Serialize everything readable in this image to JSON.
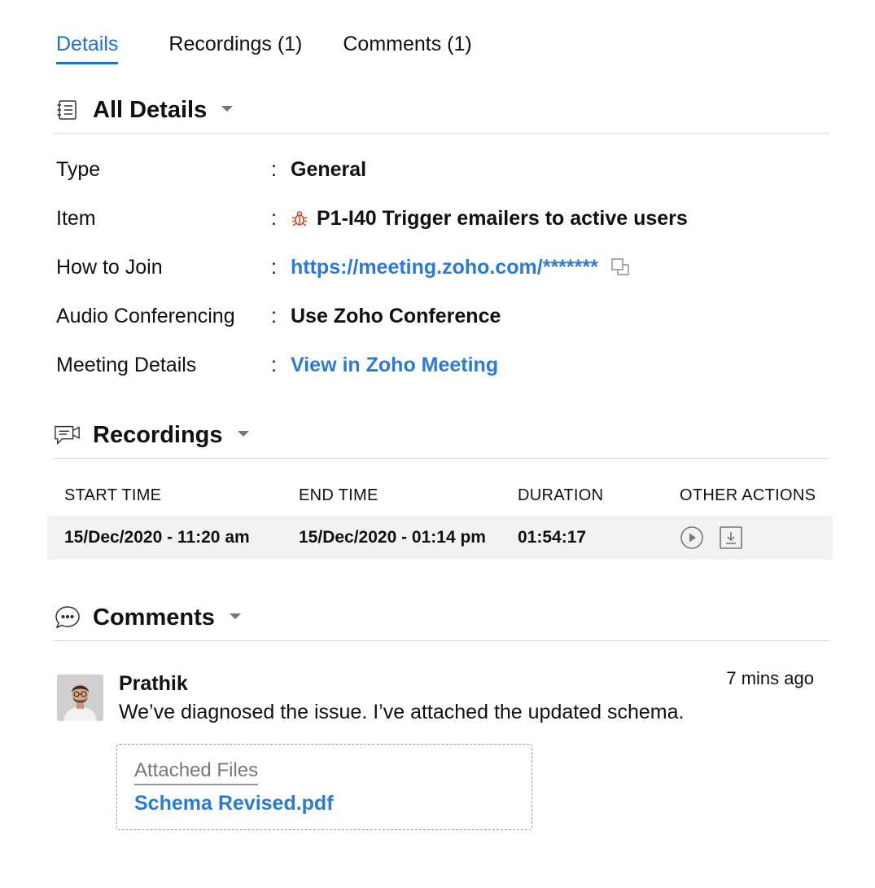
{
  "tabs": [
    {
      "label": "Details",
      "active": true
    },
    {
      "label": "Recordings (1)",
      "active": false
    },
    {
      "label": "Comments (1)",
      "active": false
    }
  ],
  "sections": {
    "details": {
      "title": "All Details",
      "icon": "list-icon"
    },
    "recordings": {
      "title": "Recordings",
      "icon": "video-chat-icon"
    },
    "comments": {
      "title": "Comments",
      "icon": "comment-bubble-icon"
    }
  },
  "details": [
    {
      "label": "Type",
      "value": "General"
    },
    {
      "label": "Item",
      "value": "P1-I40 Trigger emailers to active users",
      "icon": "bug-icon"
    },
    {
      "label": "How to Join",
      "value": "https://meeting.zoho.com/*******",
      "link": true
    },
    {
      "label": "Audio Conferencing",
      "value": "Use Zoho Conference"
    },
    {
      "label": "Meeting Details",
      "value": "View in Zoho Meeting",
      "link": true
    }
  ],
  "colon": ":",
  "recordings": {
    "headers": [
      "START TIME",
      "END TIME",
      "DURATION",
      "OTHER ACTIONS"
    ],
    "rows": [
      {
        "start": "15/Dec/2020 - 11:20 am",
        "end": "15/Dec/2020 - 01:14 pm",
        "duration": "01:54:17"
      }
    ]
  },
  "comment": {
    "author": "Prathik",
    "time": "7 mins ago",
    "text": "We’ve diagnosed the issue. I’ve attached the updated schema.",
    "attach_title": "Attached Files",
    "attach_file": "Schema Revised.pdf"
  },
  "colors": {
    "accent": "#1f6fd0",
    "link": "#2b7bd6",
    "bug": "#e0482c"
  }
}
